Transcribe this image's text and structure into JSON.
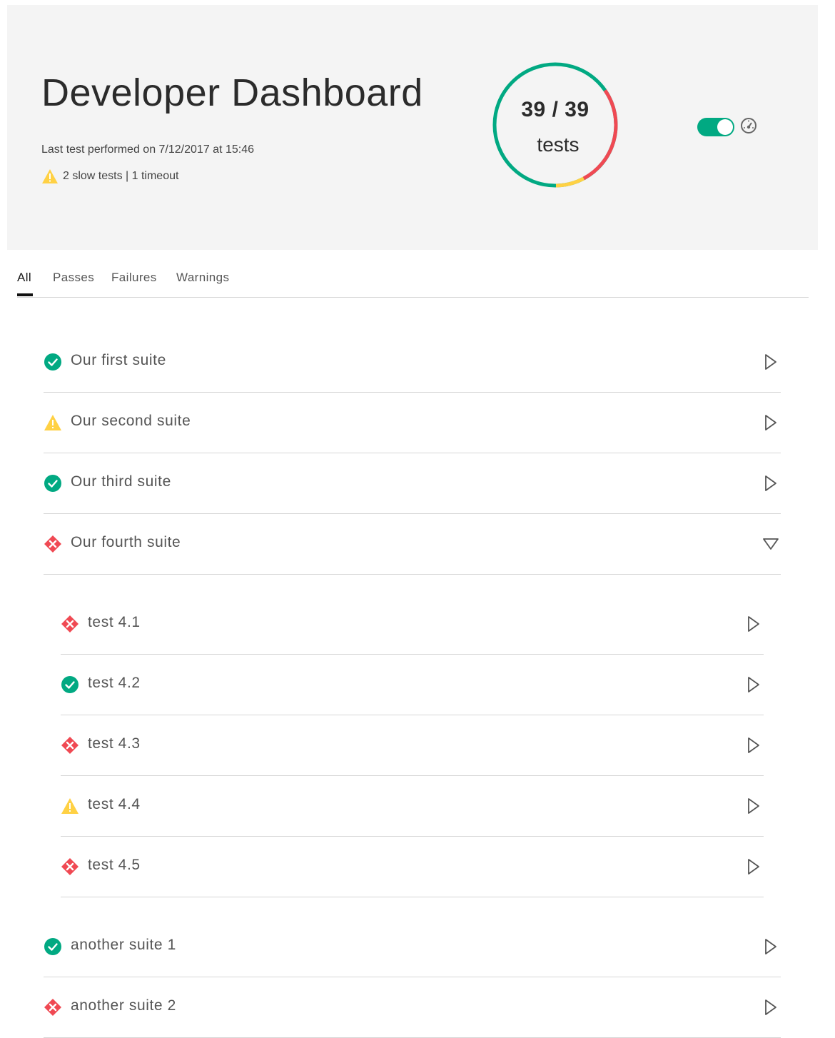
{
  "header": {
    "title": "Developer Dashboard",
    "last_test": "Last test performed on 7/12/2017 at 15:46",
    "warning_summary": "2 slow tests | 1 timeout",
    "summary_count": "39 / 39",
    "summary_label": "tests",
    "toggle_on": true,
    "colors": {
      "ok": "#01a982",
      "warning": "#ffd144",
      "critical": "#f04953",
      "background": "#f4f4f4"
    }
  },
  "tabs": [
    {
      "label": "All",
      "active": true
    },
    {
      "label": "Passes",
      "active": false
    },
    {
      "label": "Failures",
      "active": false
    },
    {
      "label": "Warnings",
      "active": false
    }
  ],
  "suites": [
    {
      "name": "Our first suite",
      "status": "ok"
    },
    {
      "name": "Our second suite",
      "status": "warning"
    },
    {
      "name": "Our third suite",
      "status": "ok"
    },
    {
      "name": "Our fourth suite",
      "status": "critical",
      "expanded": true,
      "tests": [
        {
          "name": "test 4.1",
          "status": "critical"
        },
        {
          "name": "test 4.2",
          "status": "ok"
        },
        {
          "name": "test 4.3",
          "status": "critical"
        },
        {
          "name": "test 4.4",
          "status": "warning"
        },
        {
          "name": "test 4.5",
          "status": "critical"
        }
      ]
    },
    {
      "name": "another suite 1",
      "status": "ok"
    },
    {
      "name": "another suite 2",
      "status": "critical"
    }
  ]
}
